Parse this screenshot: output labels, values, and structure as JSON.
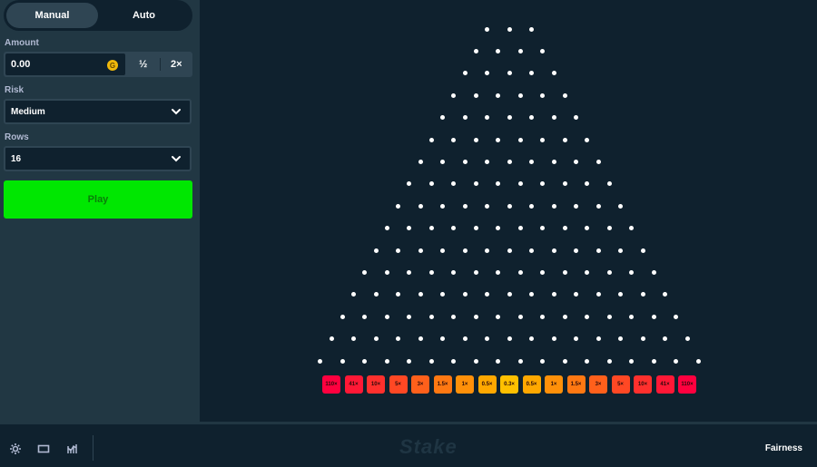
{
  "mode_tabs": {
    "manual": "Manual",
    "auto": "Auto"
  },
  "amount": {
    "label": "Amount",
    "value": "0.00",
    "coin_symbol": "G",
    "half_label": "½",
    "double_label": "2×"
  },
  "risk": {
    "label": "Risk",
    "value": "Medium"
  },
  "rows": {
    "label": "Rows",
    "value": "16"
  },
  "play_label": "Play",
  "footer": {
    "logo": "Stake",
    "fairness_label": "Fairness"
  },
  "board": {
    "first_row_pegs": 3,
    "peg_rows": 16,
    "multipliers": [
      "110×",
      "41×",
      "10×",
      "5×",
      "3×",
      "1.5×",
      "1×",
      "0.5×",
      "0.3×",
      "0.5×",
      "1×",
      "1.5×",
      "3×",
      "5×",
      "10×",
      "41×",
      "110×"
    ],
    "bucket_colors": [
      "#ff003f",
      "#ff1836",
      "#ff302d",
      "#ff4824",
      "#ff601b",
      "#ff7812",
      "#ff9009",
      "#ffa800",
      "#ffc000",
      "#ffa800",
      "#ff9009",
      "#ff7812",
      "#ff601b",
      "#ff4824",
      "#ff302d",
      "#ff1836",
      "#ff003f"
    ]
  },
  "colors": {
    "accent": "#00e701",
    "background": "#0f212e",
    "panel": "#213743"
  }
}
